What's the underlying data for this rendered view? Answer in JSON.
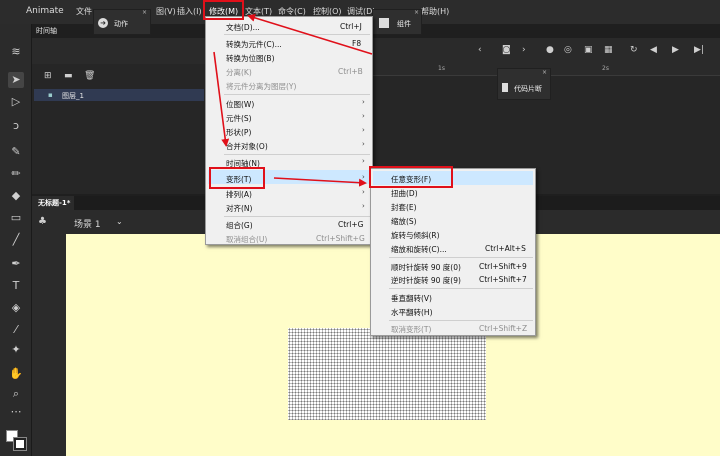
{
  "app": {
    "name": "Animate"
  },
  "menubar": {
    "file": "文件",
    "view_partial": "图(V)",
    "insert": "插入(I)",
    "modify": "修改(M)",
    "text": "文本(T)",
    "commands": "命令(C)",
    "control": "控制(O)",
    "debug": "调试(D)",
    "help_partial": "帮助(H)"
  },
  "panels": {
    "actions": "动作",
    "components": "组件",
    "code_snippets": "代码片断"
  },
  "timeline": {
    "title": "时间轴",
    "layer_name": "图层_1",
    "ruler_mark": "1s",
    "ruler_mark2": "2s"
  },
  "document": {
    "tab_title": "无标题-1*",
    "scene": "场景 1"
  },
  "modify_menu": {
    "items": [
      {
        "label": "文档(D)...",
        "shortcut": "Ctrl+J"
      },
      {
        "label": "转换为元件(C)...",
        "shortcut": "F8"
      },
      {
        "label": "转换为位图(B)",
        "shortcut": ""
      },
      {
        "label": "分离(K)",
        "shortcut": "Ctrl+B"
      },
      {
        "label": "将元件分离为图层(Y)",
        "shortcut": ""
      },
      {
        "label": "位图(W)",
        "shortcut": ""
      },
      {
        "label": "元件(S)",
        "shortcut": ""
      },
      {
        "label": "形状(P)",
        "shortcut": ""
      },
      {
        "label": "合并对象(O)",
        "shortcut": ""
      },
      {
        "label": "时间轴(N)",
        "shortcut": ""
      },
      {
        "label": "变形(T)",
        "shortcut": ""
      },
      {
        "label": "排列(A)",
        "shortcut": ""
      },
      {
        "label": "对齐(N)",
        "shortcut": ""
      },
      {
        "label": "组合(G)",
        "shortcut": "Ctrl+G"
      },
      {
        "label": "取消组合(U)",
        "shortcut": "Ctrl+Shift+G"
      }
    ]
  },
  "transform_menu": {
    "items": [
      {
        "label": "任意变形(F)",
        "shortcut": ""
      },
      {
        "label": "扭曲(D)",
        "shortcut": ""
      },
      {
        "label": "封套(E)",
        "shortcut": ""
      },
      {
        "label": "缩放(S)",
        "shortcut": ""
      },
      {
        "label": "旋转与倾斜(R)",
        "shortcut": ""
      },
      {
        "label": "缩放和旋转(C)...",
        "shortcut": "Ctrl+Alt+S"
      },
      {
        "label": "顺时针旋转 90 度(0)",
        "shortcut": "Ctrl+Shift+9"
      },
      {
        "label": "逆时针旋转 90 度(9)",
        "shortcut": "Ctrl+Shift+7"
      },
      {
        "label": "垂直翻转(V)",
        "shortcut": ""
      },
      {
        "label": "水平翻转(H)",
        "shortcut": ""
      },
      {
        "label": "取消变形(T)",
        "shortcut": "Ctrl+Shift+Z"
      }
    ]
  },
  "colors": {
    "annotation": "#e0101a",
    "stage": "#fffdc9",
    "menu_highlight": "#cde8ff"
  }
}
